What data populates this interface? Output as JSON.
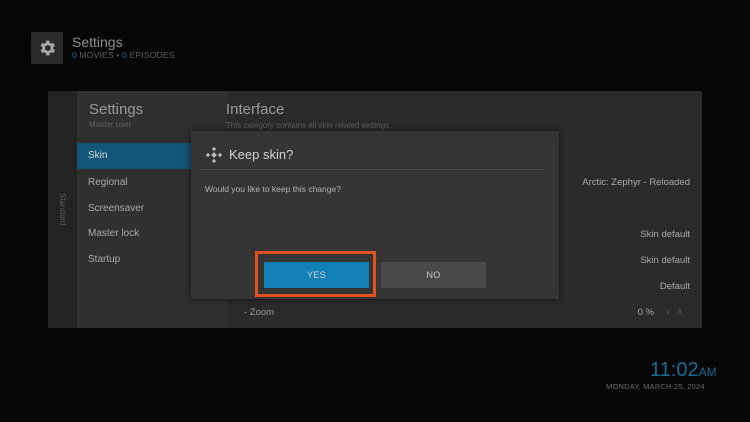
{
  "header": {
    "title": "Settings",
    "movies_count": "0",
    "movies_label": "MOVIES",
    "bullet": "•",
    "episodes_count": "0",
    "episodes_label": "EPISODES",
    "icon": "gear-icon"
  },
  "sidebar": {
    "strip_label": "Standard",
    "title": "Settings",
    "subtitle": "Master user",
    "items": [
      {
        "label": "Skin",
        "active": true
      },
      {
        "label": "Regional",
        "active": false
      },
      {
        "label": "Screensaver",
        "active": false
      },
      {
        "label": "Master lock",
        "active": false
      },
      {
        "label": "Startup",
        "active": false
      }
    ]
  },
  "settings": {
    "title": "Interface",
    "subtitle": "This category contains all skin related settings.",
    "values": [
      "Arctic: Zephyr - Reloaded",
      "Skin default",
      "Skin default",
      "Default",
      "0 %"
    ],
    "zoom_label": "- Zoom",
    "zoom_arrows": "∨ ∧"
  },
  "dialog": {
    "title": "Keep skin?",
    "message": "Would you like to keep this change?",
    "yes_label": "YES",
    "no_label": "NO",
    "icon": "kodi-icon"
  },
  "clock": {
    "time": "11:02",
    "ampm": "AM",
    "date": "MONDAY, MARCH 25, 2024"
  },
  "colors": {
    "accent": "#127fb5",
    "highlight": "#e2511f"
  }
}
